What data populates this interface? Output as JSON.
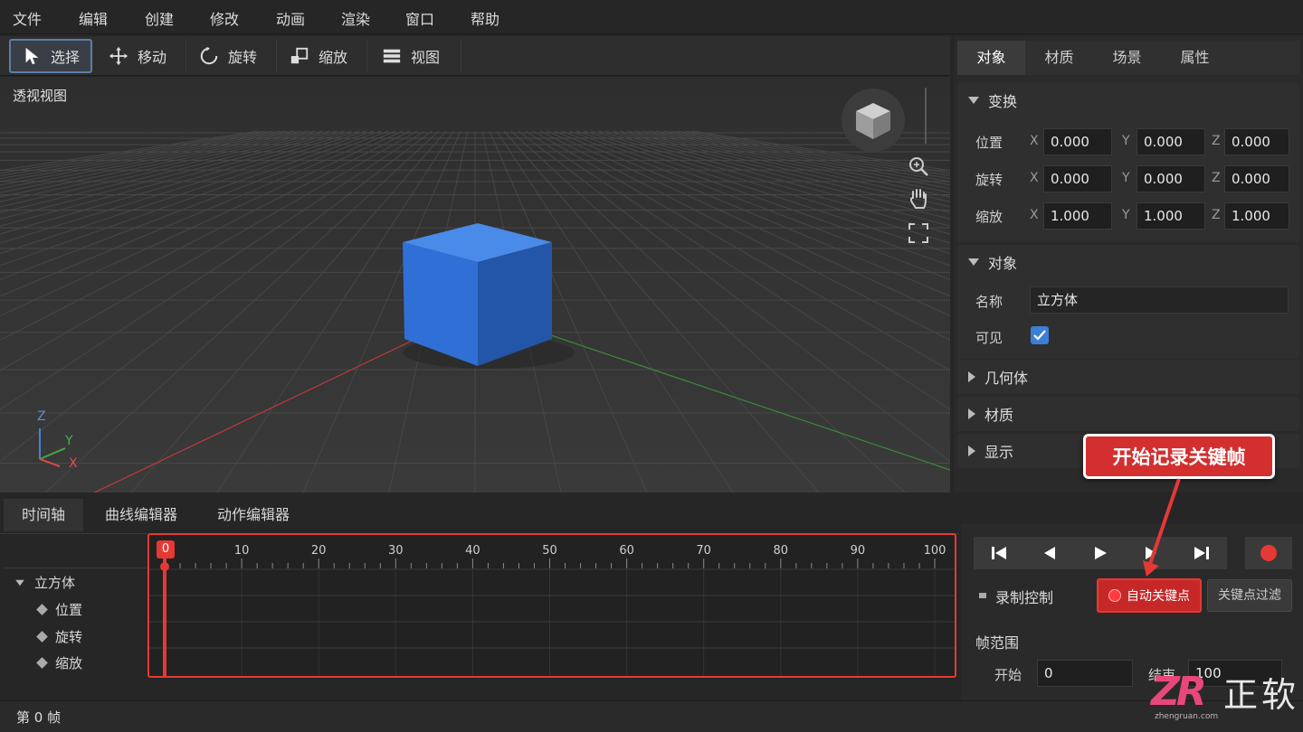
{
  "menu": [
    "文件",
    "编辑",
    "创建",
    "修改",
    "动画",
    "渲染",
    "窗口",
    "帮助"
  ],
  "toolbar": {
    "select": "选择",
    "move": "移动",
    "rotate": "旋转",
    "scale": "缩放",
    "view": "视图"
  },
  "viewport": {
    "label": "透视视图",
    "axis_z": "Z",
    "axis_y": "Y",
    "axis_x": "X",
    "cube_color": "#2f6fd6"
  },
  "right_panel": {
    "tabs": [
      "对象",
      "材质",
      "场景",
      "属性"
    ],
    "transform": {
      "title": "变换",
      "rows": [
        {
          "label": "位置",
          "x": "0.000",
          "y": "0.000",
          "z": "0.000"
        },
        {
          "label": "旋转",
          "x": "0.000",
          "y": "0.000",
          "z": "0.000"
        },
        {
          "label": "缩放",
          "x": "1.000",
          "y": "1.000",
          "z": "1.000"
        }
      ],
      "ax": "X",
      "ay": "Y",
      "az": "Z"
    },
    "object": {
      "title": "对象",
      "name_label": "名称",
      "name_value": "立方体",
      "visible_label": "可见",
      "visible": true
    },
    "geometry": "几何体",
    "material": "材质",
    "display": "显示"
  },
  "callout": "开始记录关键帧",
  "timeline": {
    "tabs": [
      "时间轴",
      "曲线编辑器",
      "动作编辑器"
    ],
    "ticks": [
      "0",
      "10",
      "20",
      "30",
      "40",
      "50",
      "60",
      "70",
      "80",
      "90",
      "100"
    ],
    "tracks": {
      "object": "立方体",
      "items": [
        "位置",
        "旋转",
        "缩放"
      ]
    },
    "current_frame": "0"
  },
  "playback": {
    "record_label": "录制控制",
    "auto_key": "自动关键点",
    "key_filter": "关键点过滤",
    "range_title": "帧范围",
    "start_label": "开始",
    "start_value": "0",
    "end_label": "结束",
    "end_value": "100"
  },
  "status": "第 0 帧",
  "watermark": {
    "logo": "ZR",
    "brand": "正软",
    "url": "zhengruan.com"
  },
  "colors": {
    "accent_red": "#e53935",
    "accent_blue": "#2f6fd6"
  }
}
